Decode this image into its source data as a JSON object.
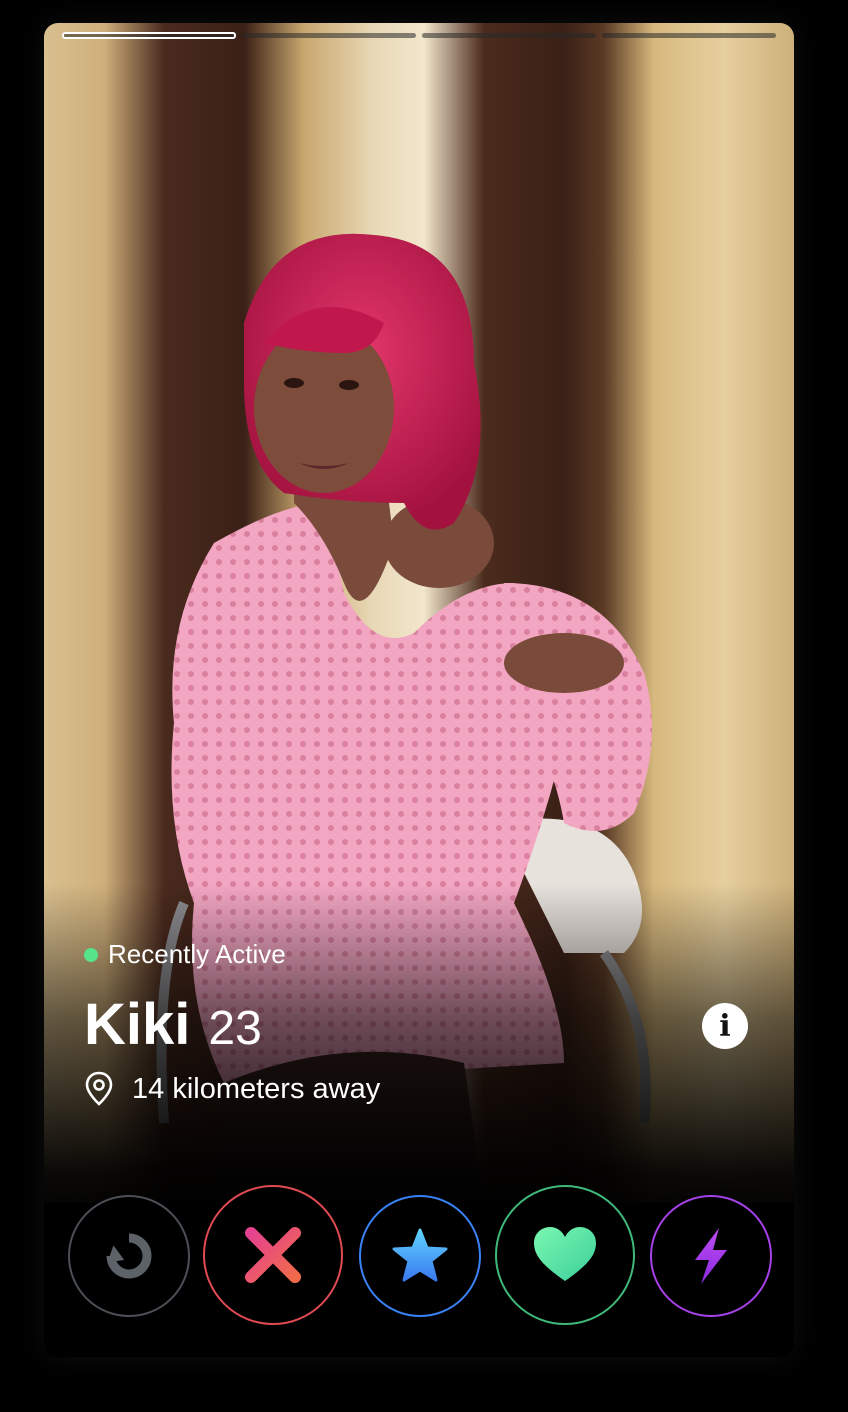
{
  "profile": {
    "status": "Recently Active",
    "name": "Kiki",
    "age": "23",
    "distance": "14 kilometers away",
    "info_glyph": "i"
  },
  "photos": {
    "count": 4,
    "current": 1
  },
  "actions": [
    {
      "name": "rewind",
      "icon": "rewind-icon",
      "color": "#4b4f56"
    },
    {
      "name": "nope",
      "icon": "x-icon",
      "color": "#e04a52"
    },
    {
      "name": "super-like",
      "icon": "star-icon",
      "color": "#3b82f6"
    },
    {
      "name": "like",
      "icon": "heart-icon",
      "color": "#3fb87a"
    },
    {
      "name": "boost",
      "icon": "lightning-icon",
      "color": "#a640e8"
    }
  ],
  "colors": {
    "active_dot": "#57e389"
  }
}
